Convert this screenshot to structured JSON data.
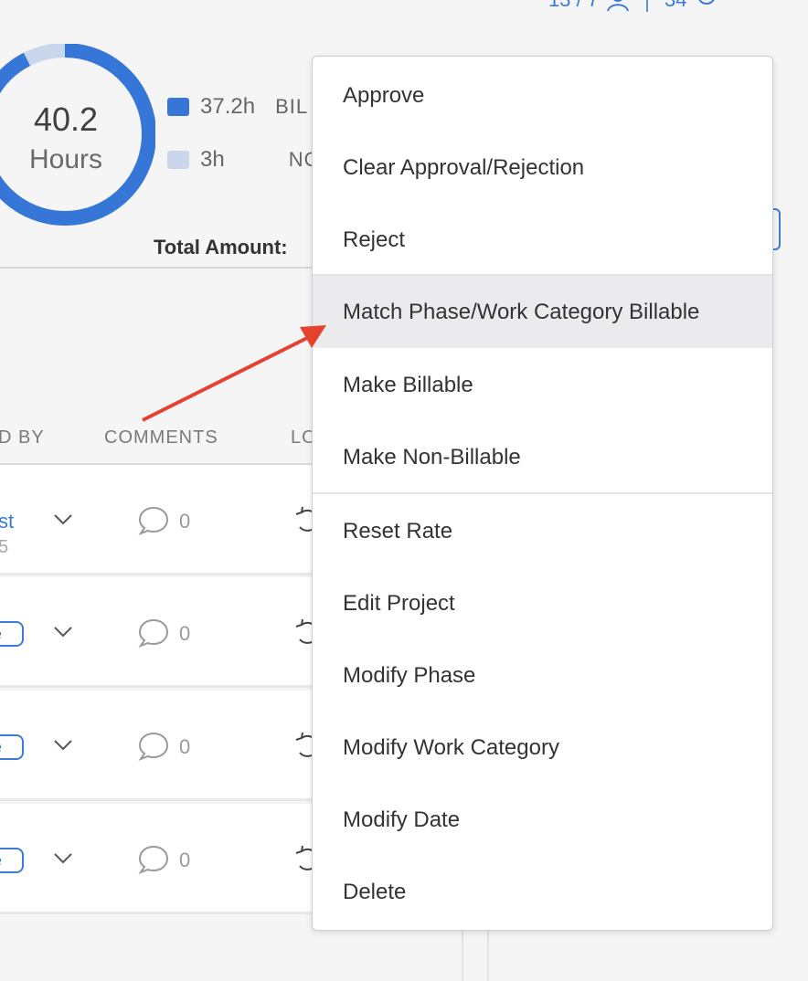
{
  "top_stats": {
    "people_count": "13 / 7",
    "views_count": "34"
  },
  "donut": {
    "value": "40.2",
    "unit": "Hours",
    "billable_fraction": 0.925
  },
  "legend": [
    {
      "value": "37.2h",
      "label": "BIL",
      "color": "#3576d6"
    },
    {
      "value": "3h",
      "label": "NO",
      "color": "#c9d6ec"
    }
  ],
  "total_amount_label": "Total Amount:",
  "table": {
    "headers": {
      "col1": "D BY",
      "col2": "COMMENTS",
      "col3": "LO"
    },
    "rows": [
      {
        "link": "st",
        "sub": "5",
        "comments": "0"
      },
      {
        "pill": "e",
        "comments": "0"
      },
      {
        "pill": "e",
        "comments": "0"
      },
      {
        "pill": "e",
        "comments": "0"
      }
    ]
  },
  "menu": {
    "items": [
      "Approve",
      "Clear Approval/Rejection",
      "Reject",
      "Match Phase/Work Category Billable",
      "Make Billable",
      "Make Non-Billable",
      "Reset Rate",
      "Edit Project",
      "Modify Phase",
      "Modify Work Category",
      "Modify Date",
      "Delete"
    ],
    "highlighted": "Match Phase/Work Category Billable"
  },
  "colors": {
    "accent": "#3a7bd5",
    "annotation_arrow": "#e5432f"
  }
}
